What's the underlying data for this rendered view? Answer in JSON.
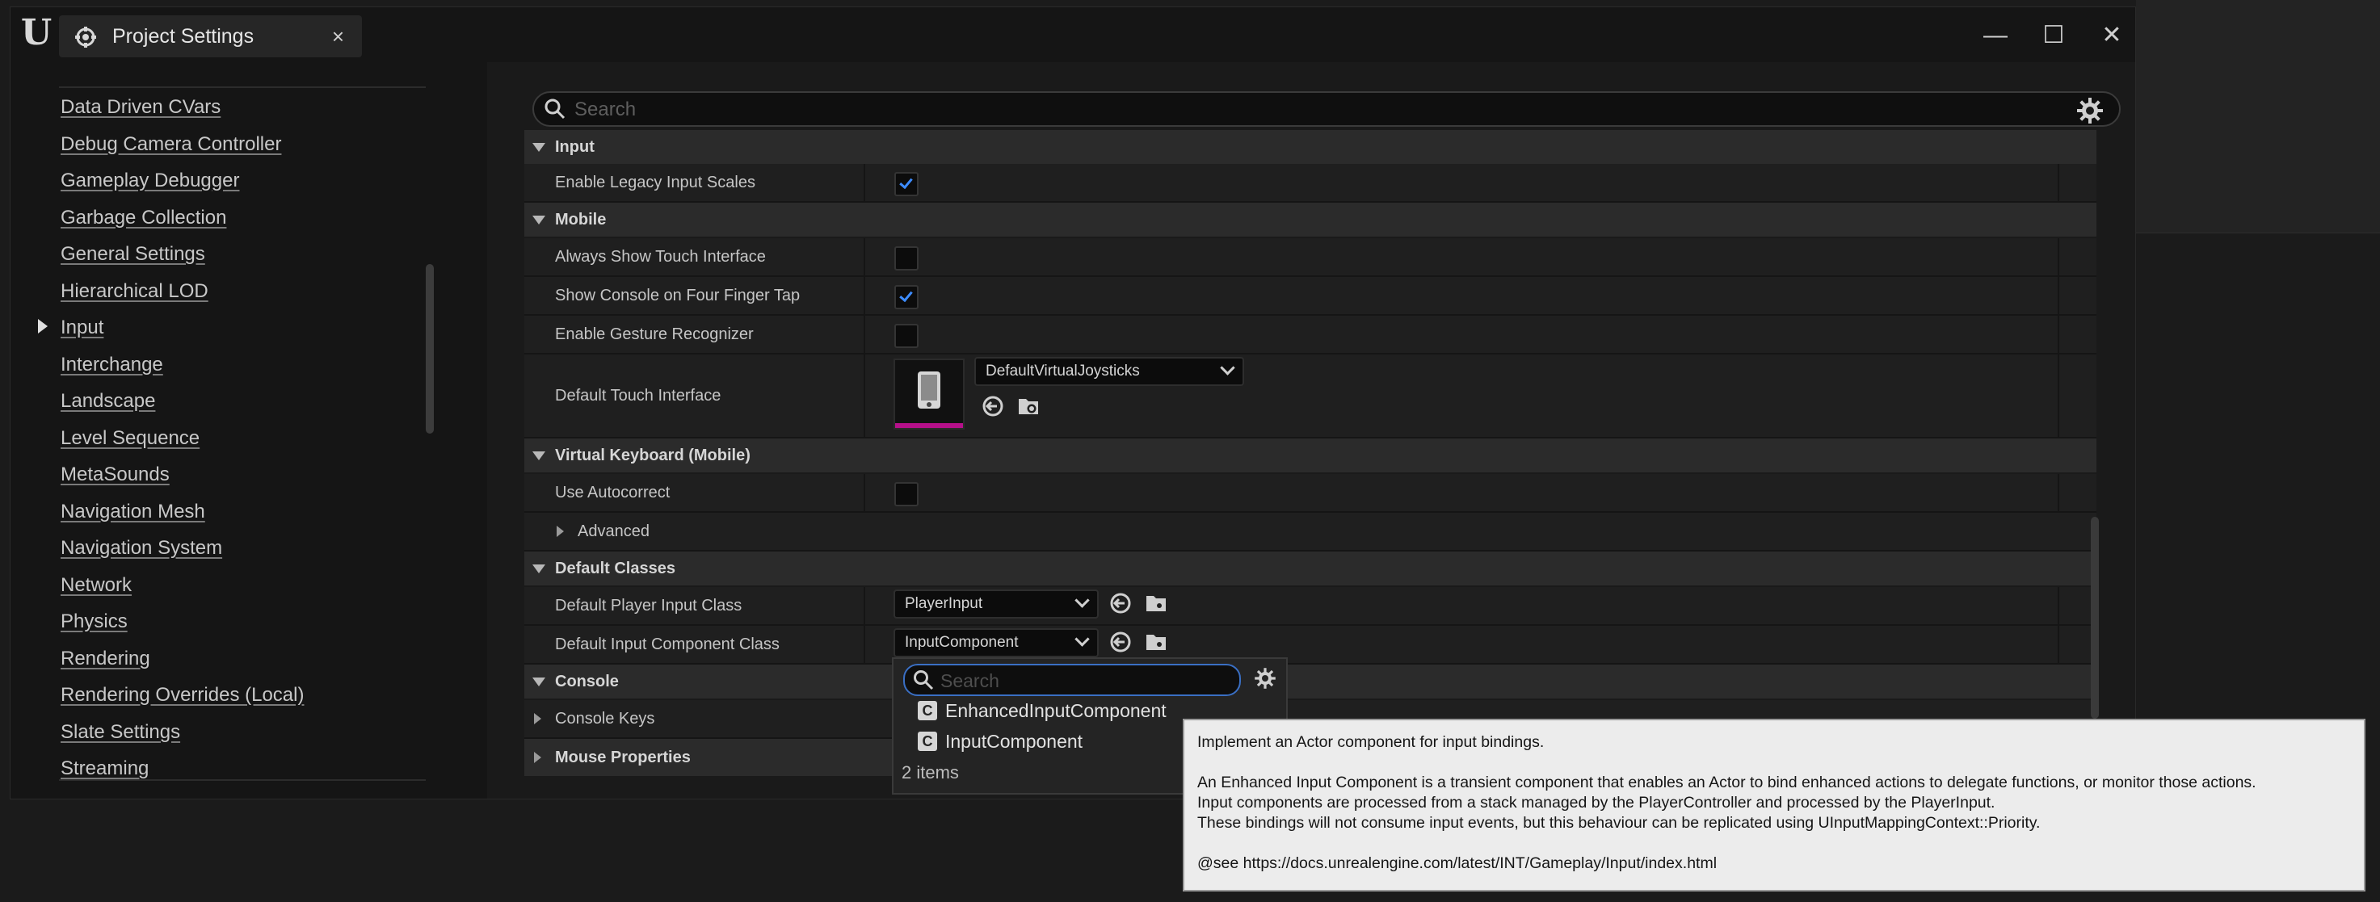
{
  "window": {
    "tab_label": "Project Settings",
    "tab_close": "×",
    "minimize": "—",
    "maximize": "☐",
    "close": "✕"
  },
  "nav": {
    "items": [
      {
        "label": "Data Driven CVars"
      },
      {
        "label": "Debug Camera Controller"
      },
      {
        "label": "Gameplay Debugger"
      },
      {
        "label": "Garbage Collection"
      },
      {
        "label": "General Settings"
      },
      {
        "label": "Hierarchical LOD"
      },
      {
        "label": "Input",
        "selected": true
      },
      {
        "label": "Interchange"
      },
      {
        "label": "Landscape"
      },
      {
        "label": "Level Sequence"
      },
      {
        "label": "MetaSounds"
      },
      {
        "label": "Navigation Mesh"
      },
      {
        "label": "Navigation System"
      },
      {
        "label": "Network"
      },
      {
        "label": "Physics"
      },
      {
        "label": "Rendering"
      },
      {
        "label": "Rendering Overrides (Local)"
      },
      {
        "label": "Slate Settings"
      },
      {
        "label": "Streaming"
      }
    ]
  },
  "search": {
    "placeholder": "Search"
  },
  "sections": {
    "input": "Input",
    "mobile": "Mobile",
    "virtual_keyboard": "Virtual Keyboard (Mobile)",
    "default_classes": "Default Classes",
    "console": "Console",
    "mouse_properties": "Mouse Properties"
  },
  "rows": {
    "enable_legacy_input_scales": {
      "label": "Enable Legacy Input Scales",
      "checked": true
    },
    "always_show_touch": {
      "label": "Always Show Touch Interface",
      "checked": false
    },
    "show_console_four_finger": {
      "label": "Show Console on Four Finger Tap",
      "checked": true
    },
    "enable_gesture": {
      "label": "Enable Gesture Recognizer",
      "checked": false
    },
    "default_touch_interface": {
      "label": "Default Touch Interface",
      "value": "DefaultVirtualJoysticks"
    },
    "use_autocorrect": {
      "label": "Use Autocorrect",
      "checked": false
    },
    "advanced": {
      "label": "Advanced"
    },
    "default_player_input_class": {
      "label": "Default Player Input Class",
      "value": "PlayerInput"
    },
    "default_input_component_class": {
      "label": "Default Input Component Class",
      "value": "InputComponent"
    },
    "console_keys": {
      "label": "Console Keys"
    }
  },
  "dropdown": {
    "search_placeholder": "Search",
    "items": [
      {
        "label": "EnhancedInputComponent"
      },
      {
        "label": "InputComponent"
      }
    ],
    "count": "2 items"
  },
  "tooltip": {
    "line1": "Implement an Actor component for input bindings.",
    "line2": "An Enhanced Input Component is a transient component that enables an Actor to bind enhanced actions to delegate functions, or monitor those actions.",
    "line3": "Input components are processed from a stack managed by the PlayerController and processed by the PlayerInput.",
    "line4": "These bindings will not consume input events, but this behaviour can be replicated using UInputMappingContext::Priority.",
    "line5": "@see https://docs.unrealengine.com/latest/INT/Gameplay/Input/index.html"
  },
  "colors": {
    "accent": "#3d8cff",
    "thumbnail_bar": "#b5108a",
    "tooltip_bg": "#ececec"
  }
}
